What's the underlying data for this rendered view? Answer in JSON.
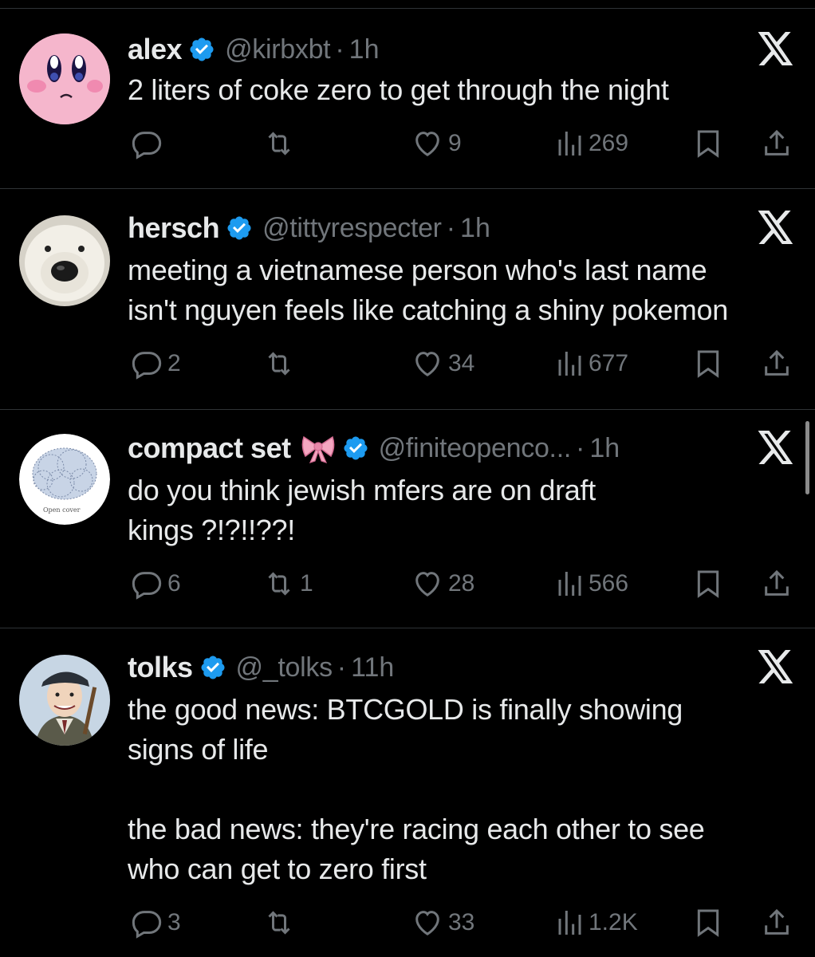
{
  "tweets": [
    {
      "name": "alex",
      "handle": "@kirbxbt",
      "time": "1h",
      "text": "2 liters of coke zero to get through the night",
      "replies": "",
      "retweets": "",
      "likes": "9",
      "views": "269",
      "avatar": "pink-round-character"
    },
    {
      "name": "hersch",
      "handle": "@tittyrespecter",
      "time": "1h",
      "text": "meeting a vietnamese person who's last name\nisn't nguyen feels like catching a shiny pokemon",
      "replies": "2",
      "retweets": "",
      "likes": "34",
      "views": "677",
      "avatar": "white-bear-dog"
    },
    {
      "name": "compact set",
      "handle": "@finiteopenco...",
      "time": "1h",
      "text": "do you think jewish mfers are on draft\nkings ?!?!!??!",
      "replies": "6",
      "retweets": "1",
      "likes": "28",
      "views": "566",
      "avatar": "open-cover-diagram",
      "avatar_caption": "Open cover"
    },
    {
      "name": "tolks",
      "handle": "@_tolks",
      "time": "11h",
      "text": "the good news: BTCGOLD is finally showing\nsigns of life\n\nthe bad news: they're racing each other to see\nwho can get to zero first",
      "replies": "3",
      "retweets": "",
      "likes": "33",
      "views": "1.2K",
      "avatar": "cartoon-man-flat-cap"
    }
  ],
  "dot": "·",
  "colors": {
    "background": "#000000",
    "text": "#e7e9ea",
    "muted": "#71767b",
    "verified": "#1d9bf0",
    "divider": "#2f3336"
  }
}
